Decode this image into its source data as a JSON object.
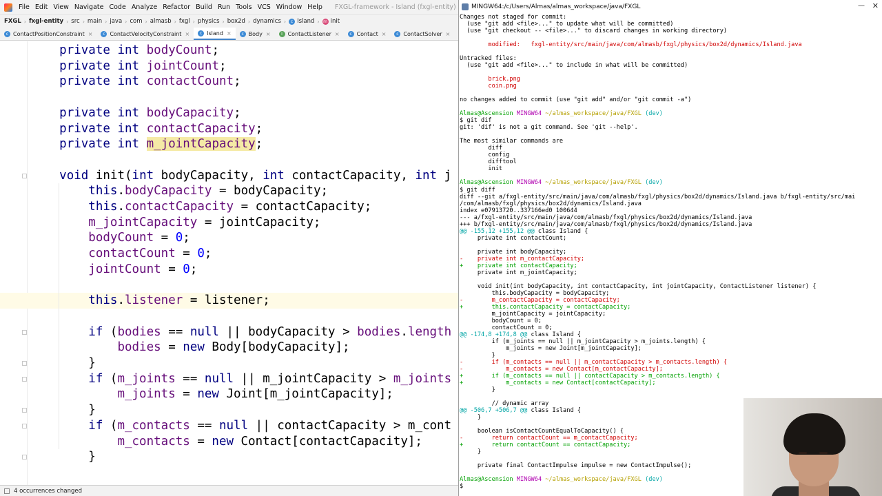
{
  "ide": {
    "menu": [
      "File",
      "Edit",
      "View",
      "Navigate",
      "Code",
      "Analyze",
      "Refactor",
      "Build",
      "Run",
      "Tools",
      "VCS",
      "Window",
      "Help"
    ],
    "window_title": "FXGL-framework - Island (fxgl-entity)",
    "breadcrumbs": [
      "FXGL",
      "fxgl-entity",
      "src",
      "main",
      "java",
      "com",
      "almasb",
      "fxgl",
      "physics",
      "box2d",
      "dynamics",
      "Island",
      "init"
    ],
    "tabs": [
      "ContactPositionConstraint",
      "ContactVelocityConstraint",
      "Island",
      "Body",
      "ContactListener",
      "Contact",
      "ContactSolver"
    ],
    "active_tab_index": 2,
    "code_lines": [
      "    private int bodyCount;",
      "    private int jointCount;",
      "    private int contactCount;",
      "",
      "    private int bodyCapacity;",
      "    private int contactCapacity;",
      "    private int m_jointCapacity;",
      "",
      "    void init(int bodyCapacity, int contactCapacity, int j",
      "        this.bodyCapacity = bodyCapacity;",
      "        this.contactCapacity = contactCapacity;",
      "        m_jointCapacity = jointCapacity;",
      "        bodyCount = 0;",
      "        contactCount = 0;",
      "        jointCount = 0;",
      "",
      "        this.listener = listener;",
      "",
      "        if (bodies == null || bodyCapacity > bodies.length",
      "            bodies = new Body[bodyCapacity];",
      "        }",
      "        if (m_joints == null || m_jointCapacity > m_joints",
      "            m_joints = new Joint[m_jointCapacity];",
      "        }",
      "        if (m_contacts == null || contactCapacity > m_cont",
      "            m_contacts = new Contact[contactCapacity];",
      "        }"
    ],
    "status_text": "4 occurrences changed"
  },
  "terminal": {
    "title": "MINGW64:/c/Users/Almas/almas_workspace/java/FXGL",
    "prompt": {
      "user": "Almas@Ascension",
      "shell": "MINGW64",
      "path": "~/almas_workspace/java/FXGL",
      "branch": "(dev)"
    },
    "lines": [
      {
        "t": "Changes not staged for commit:",
        "c": "normal"
      },
      {
        "t": "  (use \"git add <file>...\" to update what will be committed)",
        "c": "normal"
      },
      {
        "t": "  (use \"git checkout -- <file>...\" to discard changes in working directory)",
        "c": "normal"
      },
      {
        "t": "",
        "c": "normal"
      },
      {
        "t": "        modified:   fxgl-entity/src/main/java/com/almasb/fxgl/physics/box2d/dynamics/Island.java",
        "c": "red"
      },
      {
        "t": "",
        "c": "normal"
      },
      {
        "t": "Untracked files:",
        "c": "normal"
      },
      {
        "t": "  (use \"git add <file>...\" to include in what will be committed)",
        "c": "normal"
      },
      {
        "t": "",
        "c": "normal"
      },
      {
        "t": "        brick.png",
        "c": "red"
      },
      {
        "t": "        coin.png",
        "c": "red"
      },
      {
        "t": "",
        "c": "normal"
      },
      {
        "t": "no changes added to commit (use \"git add\" and/or \"git commit -a\")",
        "c": "normal"
      },
      {
        "t": "",
        "c": "normal"
      },
      {
        "t": "",
        "c": "prompt"
      },
      {
        "t": "$ git dif",
        "c": "normal"
      },
      {
        "t": "git: 'dif' is not a git command. See 'git --help'.",
        "c": "normal"
      },
      {
        "t": "",
        "c": "normal"
      },
      {
        "t": "The most similar commands are",
        "c": "normal"
      },
      {
        "t": "        diff",
        "c": "normal"
      },
      {
        "t": "        config",
        "c": "normal"
      },
      {
        "t": "        difftool",
        "c": "normal"
      },
      {
        "t": "        init",
        "c": "normal"
      },
      {
        "t": "",
        "c": "normal"
      },
      {
        "t": "",
        "c": "prompt"
      },
      {
        "t": "$ git diff",
        "c": "normal"
      },
      {
        "t": "diff --git a/fxgl-entity/src/main/java/com/almasb/fxgl/physics/box2d/dynamics/Island.java b/fxgl-entity/src/mai",
        "c": "normal"
      },
      {
        "t": "/com/almasb/fxgl/physics/box2d/dynamics/Island.java",
        "c": "normal"
      },
      {
        "t": "index e07913720..337166ed0 100644",
        "c": "normal"
      },
      {
        "t": "--- a/fxgl-entity/src/main/java/com/almasb/fxgl/physics/box2d/dynamics/Island.java",
        "c": "normal"
      },
      {
        "t": "+++ b/fxgl-entity/src/main/java/com/almasb/fxgl/physics/box2d/dynamics/Island.java",
        "c": "normal"
      },
      {
        "t": "@@ -155,12 +155,12 @@ class Island {",
        "c": "cyan"
      },
      {
        "t": "     private int contactCount;",
        "c": "normal"
      },
      {
        "t": "",
        "c": "normal"
      },
      {
        "t": "     private int bodyCapacity;",
        "c": "normal"
      },
      {
        "t": "-    private int m_contactCapacity;",
        "c": "red"
      },
      {
        "t": "+    private int contactCapacity;",
        "c": "green"
      },
      {
        "t": "     private int m_jointCapacity;",
        "c": "normal"
      },
      {
        "t": "",
        "c": "normal"
      },
      {
        "t": "     void init(int bodyCapacity, int contactCapacity, int jointCapacity, ContactListener listener) {",
        "c": "normal"
      },
      {
        "t": "         this.bodyCapacity = bodyCapacity;",
        "c": "normal"
      },
      {
        "t": "-        m_contactCapacity = contactCapacity;",
        "c": "red"
      },
      {
        "t": "+        this.contactCapacity = contactCapacity;",
        "c": "green"
      },
      {
        "t": "         m_jointCapacity = jointCapacity;",
        "c": "normal"
      },
      {
        "t": "         bodyCount = 0;",
        "c": "normal"
      },
      {
        "t": "         contactCount = 0;",
        "c": "normal"
      },
      {
        "t": "@@ -174,8 +174,8 @@ class Island {",
        "c": "cyan"
      },
      {
        "t": "         if (m_joints == null || m_jointCapacity > m_joints.length) {",
        "c": "normal"
      },
      {
        "t": "             m_joints = new Joint[m_jointCapacity];",
        "c": "normal"
      },
      {
        "t": "         }",
        "c": "normal"
      },
      {
        "t": "-        if (m_contacts == null || m_contactCapacity > m_contacts.length) {",
        "c": "red"
      },
      {
        "t": "-            m_contacts = new Contact[m_contactCapacity];",
        "c": "red"
      },
      {
        "t": "+        if (m_contacts == null || contactCapacity > m_contacts.length) {",
        "c": "green"
      },
      {
        "t": "+            m_contacts = new Contact[contactCapacity];",
        "c": "green"
      },
      {
        "t": "         }",
        "c": "normal"
      },
      {
        "t": "",
        "c": "normal"
      },
      {
        "t": "         // dynamic array",
        "c": "normal"
      },
      {
        "t": "@@ -506,7 +506,7 @@ class Island {",
        "c": "cyan"
      },
      {
        "t": "     }",
        "c": "normal"
      },
      {
        "t": "",
        "c": "normal"
      },
      {
        "t": "     boolean isContactCountEqualToCapacity() {",
        "c": "normal"
      },
      {
        "t": "-        return contactCount == m_contactCapacity;",
        "c": "red"
      },
      {
        "t": "+        return contactCount == contactCapacity;",
        "c": "green"
      },
      {
        "t": "     }",
        "c": "normal"
      },
      {
        "t": "",
        "c": "normal"
      },
      {
        "t": "     private final ContactImpulse impulse = new ContactImpulse();",
        "c": "normal"
      },
      {
        "t": "",
        "c": "normal"
      },
      {
        "t": "",
        "c": "prompt"
      },
      {
        "t": "$",
        "c": "normal"
      }
    ]
  }
}
